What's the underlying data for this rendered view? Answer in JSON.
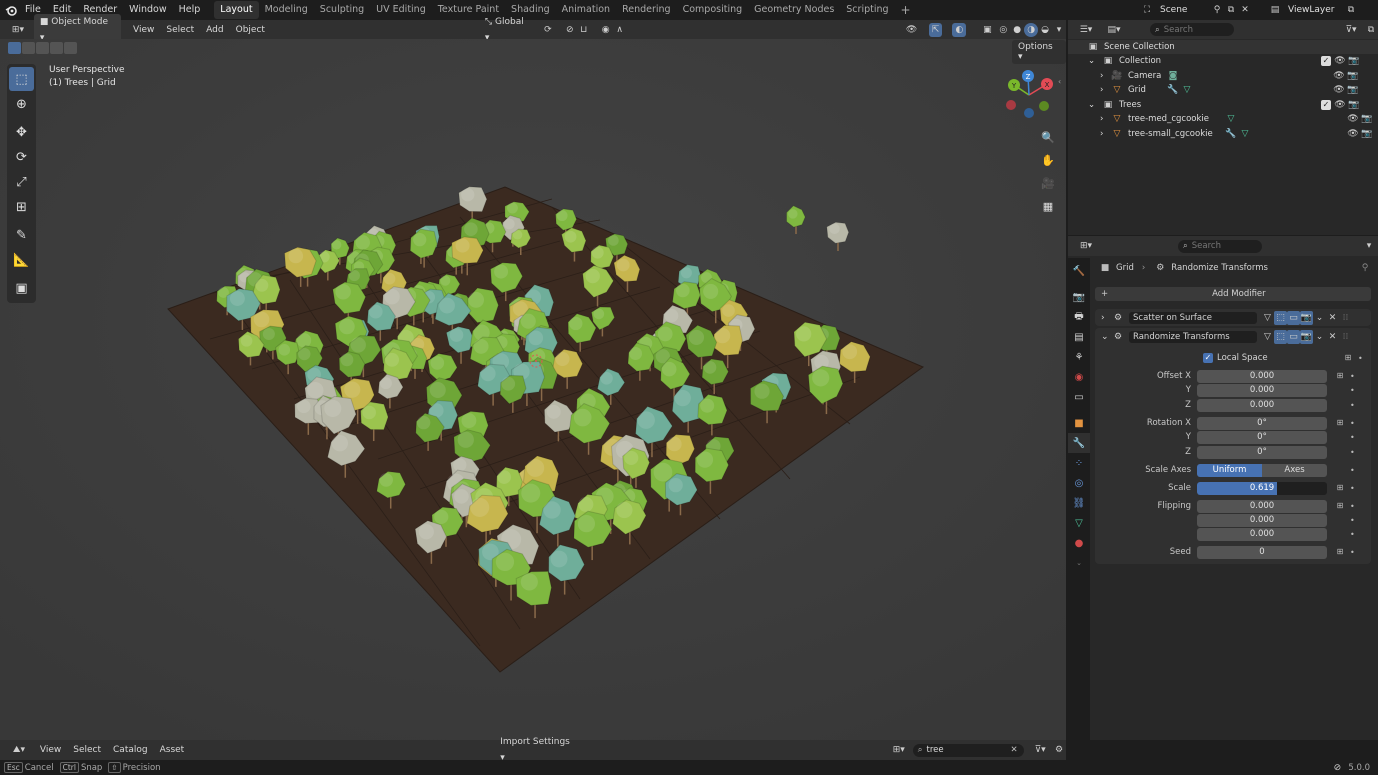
{
  "menus": [
    "File",
    "Edit",
    "Render",
    "Window",
    "Help"
  ],
  "workspace_tabs": [
    "Layout",
    "Modeling",
    "Sculpting",
    "UV Editing",
    "Texture Paint",
    "Shading",
    "Animation",
    "Rendering",
    "Compositing",
    "Geometry Nodes",
    "Scripting"
  ],
  "active_tab": "Layout",
  "scene_name": "Scene",
  "view_layer": "ViewLayer",
  "viewport_header": {
    "mode": "Object Mode",
    "menus": [
      "View",
      "Select",
      "Add",
      "Object"
    ],
    "orientation": "Global",
    "options_label": "Options"
  },
  "viewport": {
    "perspective_label": "User Perspective",
    "context_label": "(1) Trees | Grid",
    "gizmo": {
      "x": "X",
      "y": "Y",
      "z": "Z"
    }
  },
  "outliner": {
    "search_placeholder": "Search",
    "root": "Scene Collection",
    "rows": [
      {
        "label": "Collection"
      },
      {
        "label": "Camera"
      },
      {
        "label": "Grid"
      },
      {
        "label": "Trees"
      },
      {
        "label": "tree-med_cgcookie"
      },
      {
        "label": "tree-small_cgcookie"
      }
    ]
  },
  "properties": {
    "search_placeholder": "Search",
    "breadcrumb_object": "Grid",
    "breadcrumb_modifier": "Randomize Transforms",
    "add_modifier": "Add Modifier",
    "modifiers": [
      {
        "name": "Scatter on Surface"
      },
      {
        "name": "Randomize Transforms"
      }
    ],
    "local_space_label": "Local Space",
    "offset": {
      "label": "Offset X",
      "x": "0.000",
      "y_label": "Y",
      "y": "0.000",
      "z_label": "Z",
      "z": "0.000"
    },
    "rotation": {
      "label": "Rotation X",
      "x": "0°",
      "y_label": "Y",
      "y": "0°",
      "z_label": "Z",
      "z": "0°"
    },
    "scale_axes": {
      "label": "Scale Axes",
      "options": [
        "Uniform",
        "Axes"
      ],
      "selected": "Uniform"
    },
    "scale": {
      "label": "Scale",
      "value": "0.619",
      "fraction": 0.619
    },
    "flipping": {
      "label": "Flipping",
      "values": [
        "0.000",
        "0.000",
        "0.000"
      ]
    },
    "seed": {
      "label": "Seed",
      "value": "0"
    }
  },
  "asset_bar": {
    "menus": [
      "View",
      "Select",
      "Catalog",
      "Asset"
    ],
    "import_settings": "Import Settings",
    "search_value": "tree"
  },
  "status_bar": {
    "items": [
      {
        "key": "Esc",
        "label": "Cancel"
      },
      {
        "key": "Ctrl",
        "label": "Snap"
      },
      {
        "key": "⇧",
        "label": "Precision"
      }
    ],
    "version": "5.0.0"
  },
  "colors": {
    "accent": "#4772b3",
    "ground": "#3b2a20",
    "tree_green": "#7fb840",
    "tree_teal": "#6fae9a",
    "tree_gold": "#c7b64e",
    "tree_grey": "#b8b8a8"
  }
}
